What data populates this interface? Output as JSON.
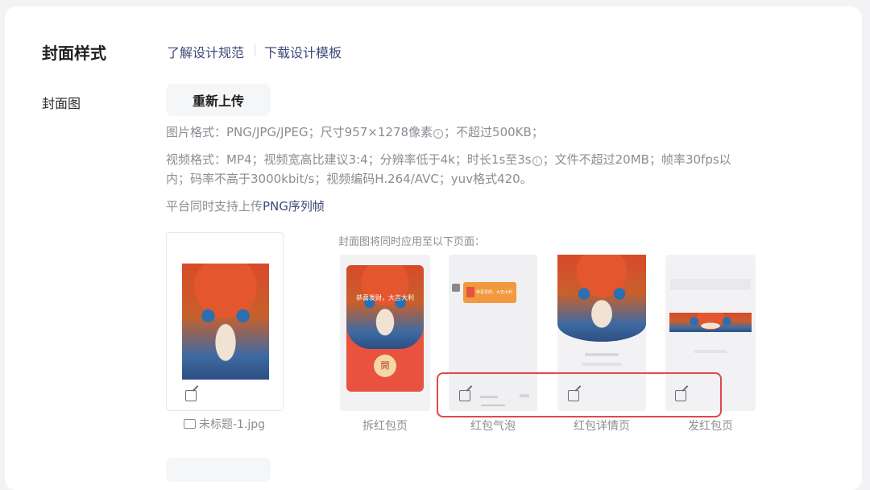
{
  "header": {
    "title": "封面样式",
    "links": [
      "了解设计规范",
      "下载设计模板"
    ]
  },
  "cover": {
    "label": "封面图",
    "reupload_label": "重新上传",
    "image_format_hint": "图片格式：PNG/JPG/JPEG；尺寸957×1278像素",
    "image_size_hint": "；不超过500KB；",
    "video_hint_part1": "视频格式：MP4；视频宽高比建议3:4；分辨率低于4k；时长1s至3s",
    "video_hint_part2": "；文件不超过20MB；帧率30fps以",
    "video_hint_line2": "内；码率不高于3000kbit/s；视频编码H.264/AVC；yuv格式420。",
    "png_hint_prefix": "平台同时支持上传",
    "png_hint_link": "PNG序列帧",
    "filename": "未标题-1.jpg",
    "apply_note": "封面图将同时应用至以下页面：",
    "previews": [
      {
        "label": "拆红包页",
        "overlay_text": "恭喜发财，大吉大利",
        "open_text": "開"
      },
      {
        "label": "红包气泡",
        "bubble_text": "恭喜发财，大吉大利"
      },
      {
        "label": "红包详情页"
      },
      {
        "label": "发红包页"
      }
    ]
  },
  "icons": [
    "info-icon",
    "edit-icon",
    "image-icon"
  ],
  "colors": {
    "link": "#3b4a78",
    "hint": "#8a8d94",
    "highlight": "#e0474f",
    "envelope_red": "#e8523f"
  }
}
